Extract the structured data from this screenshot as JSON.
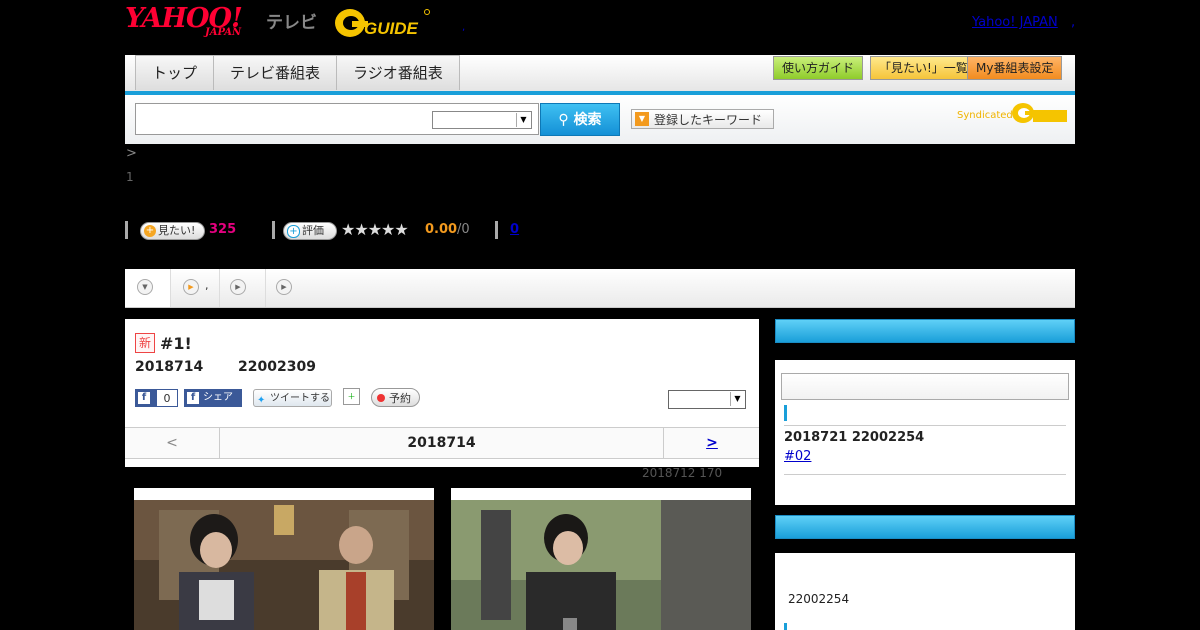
{
  "header": {
    "yahoo_logo": "YAHOO!",
    "japan_logo": "JAPAN",
    "tv_label": "テレビ",
    "gguide_logo": "GUIDE",
    "dot": ",",
    "yahoo_japan_link": "Yahoo! JAPAN",
    "link_sep": ","
  },
  "nav": {
    "tabs": [
      {
        "label": "トップ"
      },
      {
        "label": "テレビ番組表"
      },
      {
        "label": "ラジオ番組表"
      }
    ],
    "guide_button": "使い方ガイド",
    "mitai_button": "「見たい!」一覧",
    "my_button": "My番組表設定"
  },
  "search": {
    "input_value": "",
    "select_value": "",
    "search_button": "検索",
    "keyword_button": "登録したキーワード",
    "syndicated": "Syndicated"
  },
  "breadcrumb": {
    "arrow": ">",
    "line2": "1"
  },
  "rating": {
    "mitai_label": "見たい!",
    "mitai_count": "325",
    "hyoka_label": "評価",
    "stars": "★★★★★",
    "score": "0.00",
    "score_total": "/0",
    "review_link": "0"
  },
  "episode": {
    "new_badge": "新",
    "title": "#1!",
    "date": "2018714",
    "time": "22002309",
    "fb_like_count": "0",
    "fb_like_label": "",
    "fb_share_label": "シェア",
    "tweet_label": "ツイートする",
    "reserve_label": "予約",
    "select_value": "",
    "nav_prev": "<",
    "nav_date": "2018714",
    "nav_next": ">",
    "updated": "2018712  170"
  },
  "tabstrip": {
    "tab2_label": ","
  },
  "sidebar": {
    "next_date": "2018721  22002254",
    "next_link": "#02",
    "box2_time": "22002254"
  },
  "colors": {
    "accent_blue": "#1a9fd9",
    "yahoo_red": "#ff0033",
    "mitai_pink": "#e4007f",
    "score_orange": "#f39a1e"
  },
  "icons": [
    "search-icon",
    "plus-icon",
    "star-icon",
    "chevron-down-icon",
    "play-icon",
    "facebook-icon",
    "twitter-icon",
    "calendar-icon",
    "record-icon"
  ]
}
